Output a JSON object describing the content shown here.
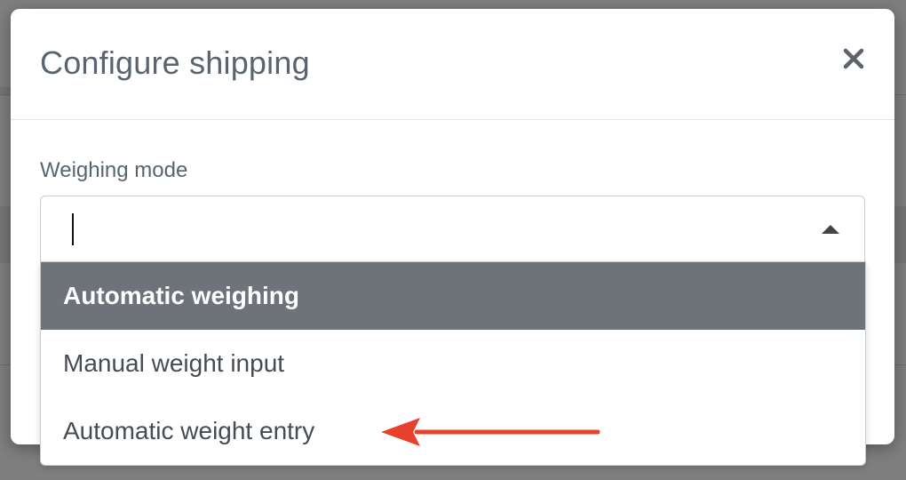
{
  "modal": {
    "title": "Configure shipping"
  },
  "form": {
    "field_label": "Weighing mode",
    "select_value": ""
  },
  "dropdown": {
    "options": [
      {
        "label": "Automatic weighing",
        "selected": true
      },
      {
        "label": "Manual weight input",
        "selected": false
      },
      {
        "label": "Automatic weight entry",
        "selected": false
      }
    ]
  },
  "colors": {
    "overlay": "#7f7f7f",
    "title_text": "#5a6470",
    "selected_option_bg": "#6d7379",
    "annotation_arrow": "#e8402a"
  },
  "icons": {
    "close": "close-icon",
    "dropdown_toggle": "chevron-up-icon",
    "annotation": "arrow-left-icon"
  }
}
